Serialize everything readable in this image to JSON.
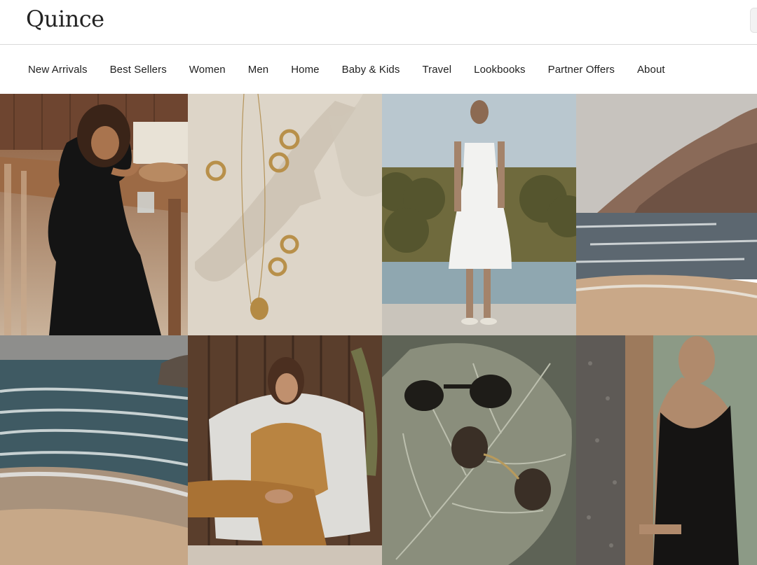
{
  "brand": {
    "name": "Quince"
  },
  "nav": {
    "items": [
      "New Arrivals",
      "Best Sellers",
      "Women",
      "Men",
      "Home",
      "Baby & Kids",
      "Travel",
      "Lookbooks",
      "Partner Offers",
      "About"
    ]
  },
  "tiles": [
    {
      "subject": "woman-black-dress-at-table"
    },
    {
      "subject": "gold-jewelry-on-driftwood"
    },
    {
      "subject": "woman-white-dress-by-pool"
    },
    {
      "subject": "coastal-cliff-and-beach"
    },
    {
      "subject": "ocean-waves-on-shore"
    },
    {
      "subject": "woman-tan-linen-set-in-chair"
    },
    {
      "subject": "sunglasses-on-leaf"
    },
    {
      "subject": "woman-black-swimsuit"
    }
  ]
}
